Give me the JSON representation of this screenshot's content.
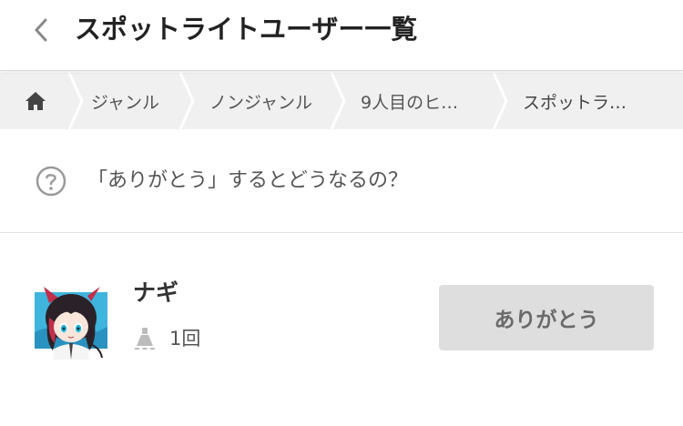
{
  "header": {
    "title": "スポットライトユーザー一覧"
  },
  "breadcrumb": {
    "items": [
      {
        "label": "",
        "icon": "home-icon"
      },
      {
        "label": "ジャンル"
      },
      {
        "label": "ノンジャンル"
      },
      {
        "label": "9人目のヒ…"
      },
      {
        "label": "スポットラ…"
      }
    ]
  },
  "faq": {
    "text": "「ありがとう」するとどうなるの？",
    "icon": "question-circle-icon"
  },
  "users": [
    {
      "name": "ナギ",
      "count": "1回",
      "count_icon": "spotlight-icon",
      "button_label": "ありがとう"
    }
  ],
  "colors": {
    "breadcrumb_bg": "#f0f0f0",
    "button_bg": "#dedede",
    "button_text": "#6a6a6a"
  }
}
